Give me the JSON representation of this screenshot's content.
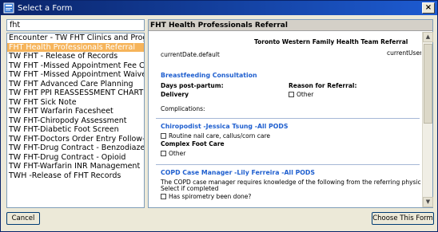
{
  "window": {
    "title": "Select a Form"
  },
  "search": {
    "value": "fht"
  },
  "forms": [
    "Encounter - TW FHT Clinics and Progra...",
    "FHT Health Professionals Referral",
    "TW FHT - Release of Records",
    "TW FHT -Missed Appointment Fee Char...",
    "TW FHT -Missed Appointment Waived ...",
    "TW FHT Advanced Care Planning",
    "TW FHT PPI REASSESSMENT CHART",
    "TW FHT Sick Note",
    "TW FHT Warfarin Facesheet",
    "TW FHT-Chiropody Assessment",
    "TW FHT-Diabetic Foot Screen",
    "TW FHT-Doctors Order Entry Follow-Up...",
    "TW FHT-Drug Contract - Benzodiazepine",
    "TW FHT-Drug Contract - Opioid",
    "TW FHT-Warfarin INR Management",
    "TWH -Release of FHT Records"
  ],
  "selected_form_index": 1,
  "preview": {
    "header": "FHT Health Professionals Referral",
    "org": "Toronto Western Family Health Team Referral",
    "current_date": "currentDate.default",
    "current_user": "currentUser",
    "breastfeeding": {
      "title": "Breastfeeding Consultation",
      "days_postpartum": "Days post-partum:",
      "delivery": "Delivery",
      "reason": "Reason for Referral:",
      "other": "Other",
      "complications": "Complications:"
    },
    "chiropodist": {
      "title": "Chiropodist -Jessica Tsung -All PODS",
      "routine": "Routine nail care, callus/corn care",
      "complex": "Complex Foot Care",
      "other": "Other"
    },
    "copd": {
      "title": "COPD Case Manager -Lily Ferreira -All PODS",
      "desc": "The COPD case manager requires knowledge of the following from the referring physician.",
      "select": "Select if completed",
      "spirometry": "Has spirometry been done?"
    }
  },
  "buttons": {
    "cancel": "Cancel",
    "choose": "Choose This Form"
  },
  "colors": {
    "selection": "#f6b45a",
    "section_title": "#1f5fcf",
    "titlebar": "#0a246a"
  }
}
